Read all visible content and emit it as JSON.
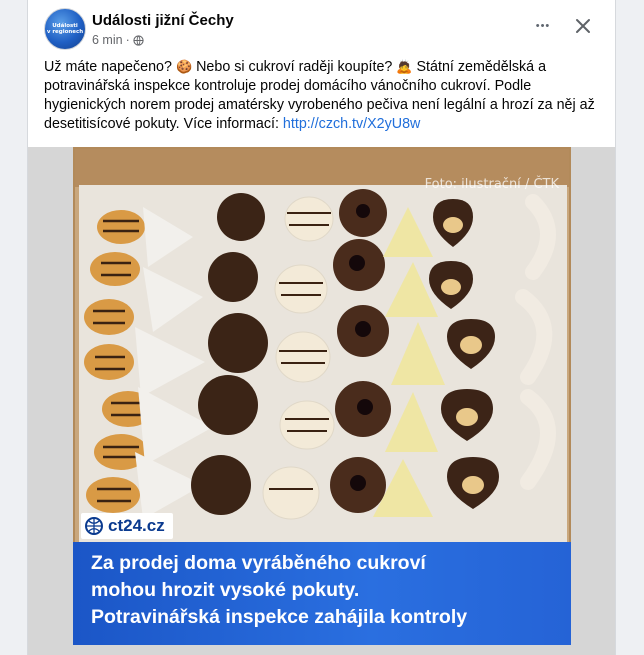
{
  "post": {
    "page_name": "Události jižní Čechy",
    "avatar_text_1": "Události",
    "avatar_text_2": "v regionech",
    "time": "6 min",
    "meta_dot": "·",
    "more_glyph": "•••",
    "text_part1": "Už máte napečeno? ",
    "emoji1": "🍪",
    "text_part2": " Nebo si cukroví raději koupíte? ",
    "emoji2": "🙇",
    "text_part3": " Státní zemědělská a potravinářská inspekce kontroluje prodej domácího vánočního cukroví. Podle hygienických norem prodej amatérsky vyrobeného pečiva není legální a hrozí za něj až desetitisícové pokuty. Více informací: ",
    "link": "http://czch.tv/X2yU8w"
  },
  "image": {
    "credit": "Foto: ilustrační / ČTK",
    "logo_text": "ct24.cz",
    "headline": [
      "Za prodej doma vyráběného cukroví",
      "mohou hrozit vysoké pokuty.",
      "Potravinářská inspekce zahájila kontroly"
    ]
  },
  "colors": {
    "link": "#216fdb",
    "headline_bg": "#2563d6",
    "box": "#c9a97f"
  },
  "icons": [
    "globe-icon",
    "more-icon",
    "close-icon",
    "ct24-logo-icon"
  ]
}
